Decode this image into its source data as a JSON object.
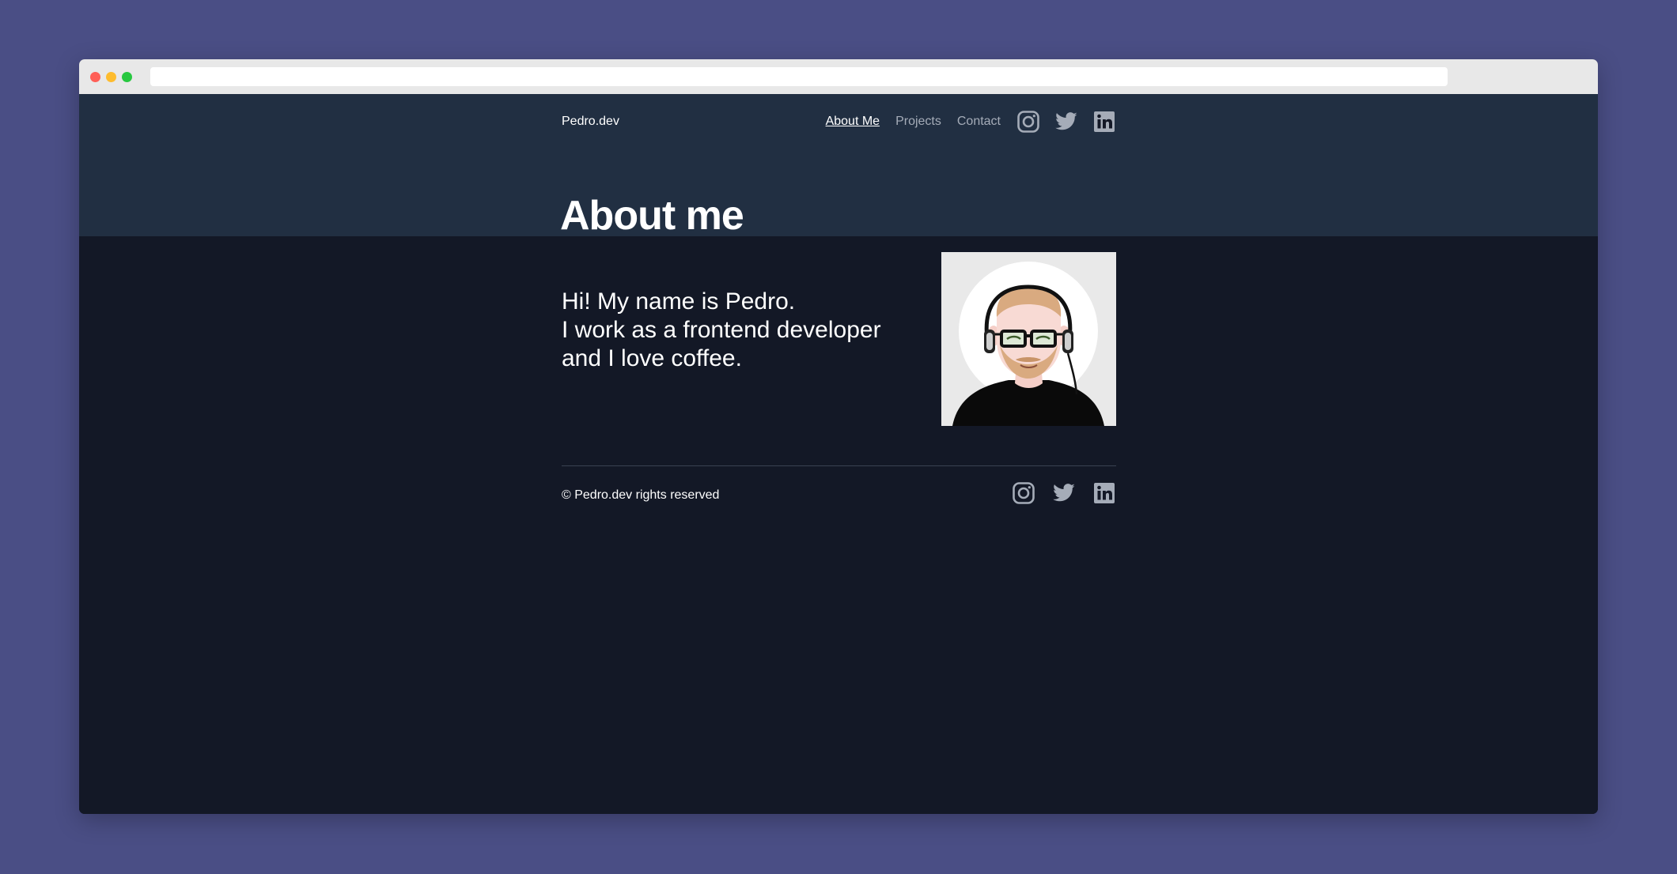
{
  "colors": {
    "background": "#4a4e85",
    "page_dark": "#131826",
    "hero_band": "#212f42",
    "nav_inactive": "#a5acb8",
    "text": "#ffffff",
    "icon": "#a5acb8"
  },
  "header": {
    "brand": "Pedro.dev",
    "nav": [
      {
        "label": "About Me",
        "active": true
      },
      {
        "label": "Projects",
        "active": false
      },
      {
        "label": "Contact",
        "active": false
      }
    ],
    "social_icons": [
      "instagram-icon",
      "twitter-icon",
      "linkedin-icon"
    ]
  },
  "main": {
    "title": "About me",
    "intro_lines": [
      "Hi! My name is Pedro.",
      "I work as a frontend developer",
      "and I love coffee."
    ],
    "avatar": "avatar-illustration"
  },
  "footer": {
    "copyright": "© Pedro.dev rights reserved",
    "social_icons": [
      "instagram-icon",
      "twitter-icon",
      "linkedin-icon"
    ]
  }
}
